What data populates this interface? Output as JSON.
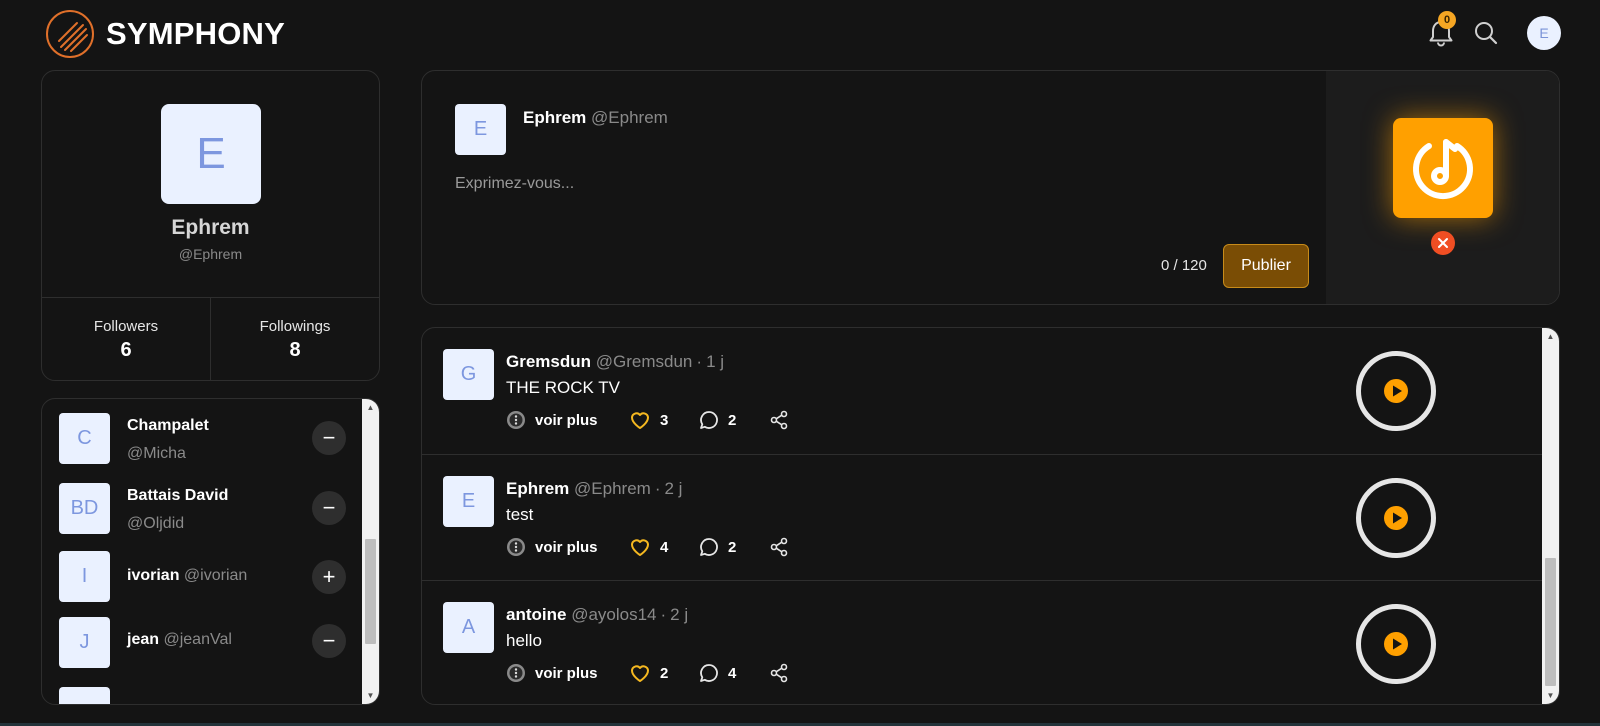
{
  "header": {
    "brand": "SYMPHONY",
    "notification_count": "0",
    "user_initial": "E",
    "icons": [
      "logo-icon",
      "bell-icon",
      "search-icon"
    ]
  },
  "profile": {
    "initial": "E",
    "name": "Ephrem",
    "handle": "@Ephrem",
    "followers_label": "Followers",
    "followers_count": "6",
    "followings_label": "Followings",
    "followings_count": "8"
  },
  "follow_list": [
    {
      "initial": "C",
      "name": "Champalet",
      "handle": "@Micha",
      "action": "−"
    },
    {
      "initial": "BD",
      "name": "Battais David",
      "handle": "@Oljdid",
      "action": "−"
    },
    {
      "initial": "I",
      "name": "ivorian",
      "handle": "@ivorian",
      "action": "+"
    },
    {
      "initial": "J",
      "name": "jean",
      "handle": "@jeanVal",
      "action": "−"
    }
  ],
  "composer": {
    "initial": "E",
    "name": "Ephrem",
    "handle": "@Ephrem",
    "placeholder": "Exprimez-vous...",
    "char_count": "0 / 120",
    "publish_label": "Publier"
  },
  "posts": [
    {
      "initial": "G",
      "author": "Gremsdun",
      "handle": "@Gremsdun",
      "time": "1 j",
      "text": "THE ROCK TV",
      "more_label": "voir plus",
      "likes": "3",
      "comments": "2"
    },
    {
      "initial": "E",
      "author": "Ephrem",
      "handle": "@Ephrem",
      "time": "2 j",
      "text": "test",
      "more_label": "voir plus",
      "likes": "4",
      "comments": "2"
    },
    {
      "initial": "A",
      "author": "antoine",
      "handle": "@ayolos14",
      "time": "2 j",
      "text": "hello",
      "more_label": "voir plus",
      "likes": "2",
      "comments": "4"
    }
  ],
  "colors": {
    "background": "#141414",
    "accent": "#ffa000",
    "logo_orange": "#e0702a",
    "publish_bg": "#7a4d05",
    "avatar_bg": "#eaf1ff",
    "avatar_text": "#7d97df",
    "remove_red": "#f04e23"
  }
}
